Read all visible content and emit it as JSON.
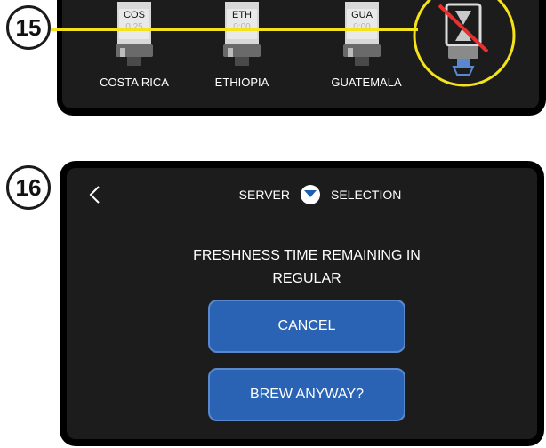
{
  "step15": {
    "number": "15",
    "servers": [
      {
        "code": "COS",
        "value": "0:25",
        "name": "COSTA RICA"
      },
      {
        "code": "ETH",
        "value": "0:00",
        "name": "ETHIOPIA"
      },
      {
        "code": "GUA",
        "value": "0:00",
        "name": "GUATEMALA"
      }
    ],
    "highlight_color": "#f4e21a",
    "slash_color": "#e8312e"
  },
  "step16": {
    "number": "16",
    "header": {
      "left": "SERVER",
      "right": "SELECTION"
    },
    "message_line1": "FRESHNESS TIME REMAINING IN",
    "message_line2": "REGULAR",
    "cancel_label": "CANCEL",
    "brew_label": "BREW ANYWAY?",
    "button_color": "#2a63b3"
  }
}
